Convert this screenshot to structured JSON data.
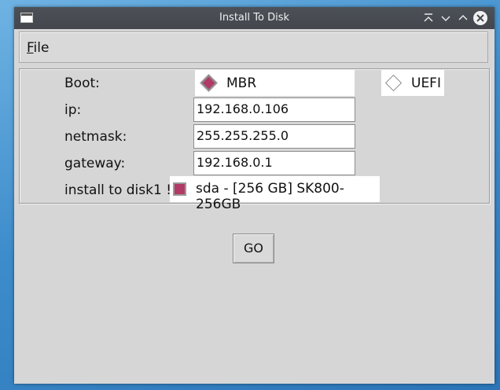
{
  "window": {
    "title": "Install To Disk"
  },
  "titlebar_icons": [
    "app-icon",
    "keep-above-icon",
    "minimize-icon",
    "maximize-icon",
    "close-icon"
  ],
  "menu": {
    "file_first": "F",
    "file_rest": "ile"
  },
  "form": {
    "boot_label": "Boot:",
    "boot_options": [
      {
        "label": "MBR",
        "selected": true
      },
      {
        "label": "UEFI",
        "selected": false
      }
    ],
    "ip_label": "ip:",
    "ip_value": "192.168.0.106",
    "netmask_label": "netmask:",
    "netmask_value": "255.255.255.0",
    "gateway_label": "gateway:",
    "gateway_value": "192.168.0.1",
    "disk_label": "install to disk1 !",
    "disk_option": "sda - [256 GB] SK800-256GB",
    "disk_checked": true
  },
  "actions": {
    "go_label": "GO"
  },
  "colors": {
    "accent": "#b23a66",
    "window_bg": "#d6d6d6",
    "titlebar_bg": "#474b51"
  }
}
